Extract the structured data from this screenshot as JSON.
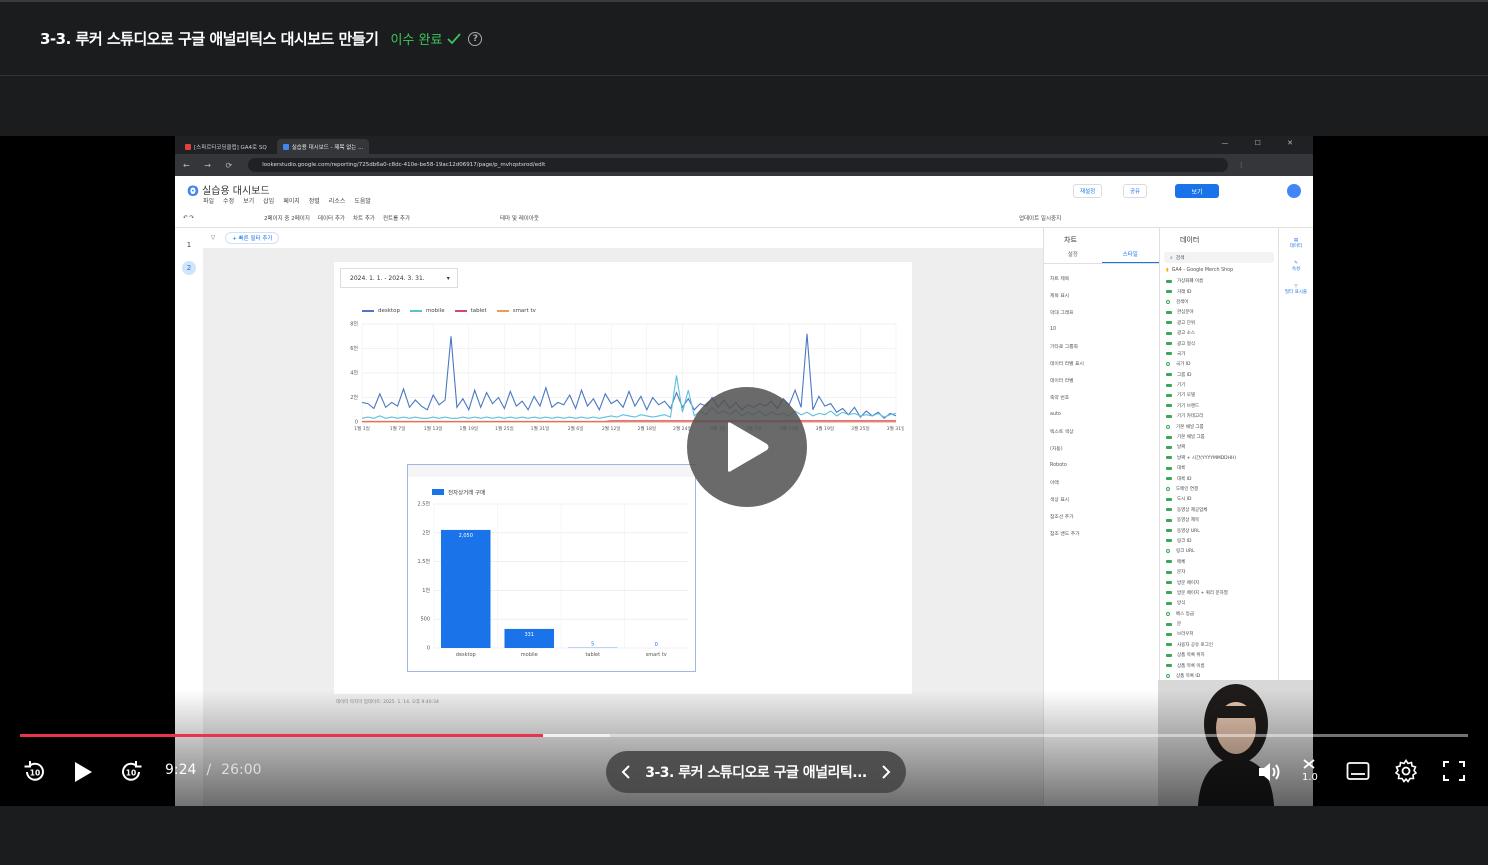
{
  "header": {
    "title": "3-3. 루커 스튜디오로 구글 애널리틱스 대시보드 만들기",
    "status": "이수 완료",
    "help_glyph": "?"
  },
  "colors": {
    "accent_red": "#e8344e",
    "done_green": "#3dc55e"
  },
  "browser": {
    "tabs": [
      "[스파르타코딩클럽] GA4로 SQ",
      "실습용 대시보드 - 제목 없는 ..."
    ],
    "url": "lookerstudio.google.com/reporting/725db6a0-c8dc-410e-be58-19ac12d06917/page/p_mvhqstsrod/edit"
  },
  "looker": {
    "report_title": "실습용 대시보드",
    "menus": [
      "파일",
      "수정",
      "보기",
      "삽입",
      "페이지",
      "정렬",
      "리소스",
      "도움말"
    ],
    "header_buttons": {
      "reset": "재설정",
      "share": "공유",
      "view": "보기"
    },
    "toolbar": [
      "2페이지 중 2페이지",
      "데이터 추가",
      "차트 추가",
      "컨트롤 추가",
      "테마 및 레이아웃"
    ],
    "right_toolbar": "업데이트 일시중지",
    "pages": [
      "1",
      "2"
    ],
    "filter_label": "+ 빠른 필터 추가",
    "date_range": "2024. 1. 1. - 2024. 3. 31.",
    "footer": "데이터 마지막 업데이트: 2025. 1. 14. 오후 9:40:34"
  },
  "chart_data": [
    {
      "type": "line",
      "series": [
        {
          "name": "desktop",
          "color": "#4a78c2",
          "values": [
            1.6,
            1.5,
            1.1,
            2.3,
            1.2,
            1.6,
            1.3,
            2.7,
            1.2,
            1.8,
            1.3,
            1.0,
            2.2,
            1.4,
            1.8,
            7.0,
            1.2,
            1.9,
            1.0,
            2.6,
            1.2,
            2.4,
            1.5,
            2.0,
            1.1,
            2.5,
            1.3,
            1.7,
            1.0,
            2.1,
            1.3,
            2.8,
            1.2,
            1.6,
            1.4,
            2.2,
            1.1,
            2.6,
            1.3,
            1.9,
            1.0,
            2.3,
            1.5,
            1.8,
            1.2,
            2.5,
            1.3,
            2.1,
            1.0,
            2.0,
            1.4,
            1.7,
            1.1,
            2.4,
            1.2,
            1.9,
            1.0,
            1.5,
            1.3,
            2.0,
            1.2,
            1.8,
            1.1,
            1.6,
            1.0,
            1.4,
            1.2,
            1.5,
            1.3,
            1.7,
            1.1,
            1.9,
            1.4,
            2.6,
            1.2,
            7.2,
            1.0,
            2.1,
            1.3,
            1.5,
            0.8,
            1.1,
            0.6,
            1.2,
            0.4,
            0.9,
            0.5,
            0.8,
            0.3,
            0.7,
            0.5
          ]
        },
        {
          "name": "mobile",
          "color": "#5bc0de",
          "values": [
            0.3,
            0.4,
            0.3,
            0.5,
            0.3,
            0.4,
            0.3,
            0.4,
            0.3,
            0.4,
            0.3,
            0.3,
            0.4,
            0.3,
            0.4,
            0.3,
            0.3,
            0.4,
            0.3,
            0.4,
            0.3,
            0.4,
            0.3,
            0.4,
            0.3,
            0.4,
            0.3,
            0.4,
            0.3,
            0.4,
            0.3,
            0.4,
            0.3,
            0.4,
            0.3,
            0.4,
            0.3,
            0.4,
            0.3,
            0.4,
            0.3,
            0.4,
            0.5,
            0.4,
            0.6,
            0.5,
            0.4,
            0.6,
            0.5,
            0.4,
            0.5,
            0.6,
            0.4,
            3.8,
            0.8,
            2.6,
            0.5,
            0.9,
            0.6,
            1.2,
            0.7,
            0.9,
            0.6,
            1.0,
            0.5,
            0.8,
            0.6,
            0.9,
            0.5,
            0.8,
            0.6,
            0.7,
            0.5,
            0.9,
            0.6,
            0.8,
            0.5,
            0.7,
            0.6,
            0.9,
            0.5,
            0.8,
            0.6,
            0.7,
            0.5,
            0.6,
            0.5,
            0.7,
            0.4,
            0.6,
            0.7
          ]
        },
        {
          "name": "tablet",
          "color": "#d9436f",
          "values": [
            0.05,
            0.05,
            0.05,
            0.05,
            0.05,
            0.05,
            0.05,
            0.05,
            0.05,
            0.05,
            0.05,
            0.05,
            0.05,
            0.05,
            0.05,
            0.05,
            0.05,
            0.05,
            0.05,
            0.05,
            0.05,
            0.05,
            0.05,
            0.05,
            0.05,
            0.05,
            0.05,
            0.05,
            0.05,
            0.05,
            0.05,
            0.05,
            0.05,
            0.05,
            0.05,
            0.05,
            0.05,
            0.05,
            0.05,
            0.05,
            0.05,
            0.05,
            0.1,
            0.1,
            0.1,
            0.1,
            0.1,
            0.1,
            0.1,
            0.1,
            0.1,
            0.1,
            0.1,
            0.1,
            0.1,
            0.1,
            0.1,
            0.1,
            0.1,
            0.1,
            0.1,
            0.1,
            0.1,
            0.1,
            0.1,
            0.1,
            0.1,
            0.1,
            0.1,
            0.1,
            0.1,
            0.1,
            0.1,
            0.1,
            0.1,
            0.1,
            0.1,
            0.1,
            0.1,
            0.1,
            0.1,
            0.1,
            0.1,
            0.1,
            0.1,
            0.1,
            0.1,
            0.1,
            0.1,
            0.1,
            0.1
          ]
        },
        {
          "name": "smart tv",
          "color": "#ef9a52",
          "values": [
            0,
            0,
            0,
            0,
            0,
            0,
            0,
            0,
            0,
            0,
            0,
            0,
            0,
            0,
            0,
            0,
            0,
            0,
            0,
            0,
            0,
            0,
            0,
            0,
            0,
            0,
            0,
            0,
            0,
            0,
            0,
            0,
            0,
            0,
            0,
            0,
            0,
            0,
            0,
            0,
            0,
            0,
            0,
            0,
            0,
            0,
            0,
            0,
            0,
            0,
            0,
            0,
            0,
            0,
            0,
            0,
            0,
            0,
            0,
            0,
            0,
            0,
            0,
            0,
            0,
            0,
            0,
            0,
            0,
            0,
            0,
            0,
            0,
            0,
            0,
            0,
            0,
            0,
            0,
            0,
            0,
            0,
            0,
            0,
            0,
            0,
            0,
            0,
            0,
            0,
            0
          ]
        }
      ],
      "x_tick_labels": [
        "1월 1일",
        "1월 7일",
        "1월 13일",
        "1월 19일",
        "1월 25일",
        "1월 31일",
        "2월 6일",
        "2월 12일",
        "2월 18일",
        "2월 24일",
        "3월 1일",
        "3월 7일",
        "3월 13일",
        "3월 19일",
        "3월 25일",
        "3월 31일"
      ],
      "y_tick_labels": [
        "0",
        "2천",
        "4천",
        "6천",
        "8천"
      ],
      "ylim": [
        0,
        8
      ],
      "legend_position": "top-left",
      "grid": true
    },
    {
      "type": "bar",
      "categories": [
        "desktop",
        "mobile",
        "tablet",
        "smart tv"
      ],
      "values": [
        2050,
        331,
        5,
        0
      ],
      "data_labels": [
        "2,050",
        "331",
        "5",
        "0"
      ],
      "series_name": "전자상거래 구매",
      "color": "#1a73e8",
      "y_tick_labels": [
        "0",
        "500",
        "1천",
        "1.5천",
        "2천",
        "2.5천"
      ],
      "ylim": [
        0,
        2500
      ],
      "grid": true
    }
  ],
  "chart_panel": {
    "title": "차트",
    "subtabs": [
      "설정",
      "스타일"
    ],
    "rows": [
      "차트 제목",
      "제목 표시",
      "막대 그래프",
      "10",
      "기타로 그룹화",
      "데이터 라벨 표시",
      "데이터 라벨",
      "축약 번호",
      "auto",
      "텍스트 색상",
      "(자동)",
      "Roboto",
      "아래",
      "색상 표시",
      "참조선 추가",
      "참조 밴드 추가"
    ]
  },
  "data_panel": {
    "title": "데이터",
    "search_placeholder": "검색",
    "source": "GA4 - Google Merch Shop",
    "fields": [
      "가상화폐 이름",
      "거래 ID",
      "검색어",
      "관심분야",
      "광고 단위",
      "광고 소스",
      "광고 형식",
      "국가",
      "국가 ID",
      "그룹 ID",
      "기기",
      "기기 모델",
      "기기 브랜드",
      "기기 카테고리",
      "기본 채널 그룹",
      "기본 채널 그룹",
      "날짜",
      "날짜 + 시간(YYYYMMDDHH)",
      "대륙",
      "대륙 ID",
      "도메인 연결",
      "도시 ID",
      "동영상 제공업체",
      "동영상 제목",
      "동영상 URL",
      "링크 ID",
      "링크 URL",
      "매체",
      "문자",
      "방문 페이지",
      "방문 페이지 + 쿼리 문자열",
      "방식",
      "베스 등급",
      "분",
      "브라우저",
      "사용자 공유 로그인",
      "상품 목록 위치",
      "상품 목록 이름",
      "상품 목록 ID",
      "상품 브랜드",
      "상품 카테고리",
      "상품 카테고리 2"
    ]
  },
  "side_rail": [
    "데이터",
    "속성",
    "필터 표시줄"
  ],
  "player": {
    "current_time": "9:24",
    "separator": "/",
    "duration": "26:00",
    "progress": 0.3615,
    "next_title": "3-3. 루커 스튜디오로 구글 애널리틱...",
    "speed": "1.0"
  }
}
